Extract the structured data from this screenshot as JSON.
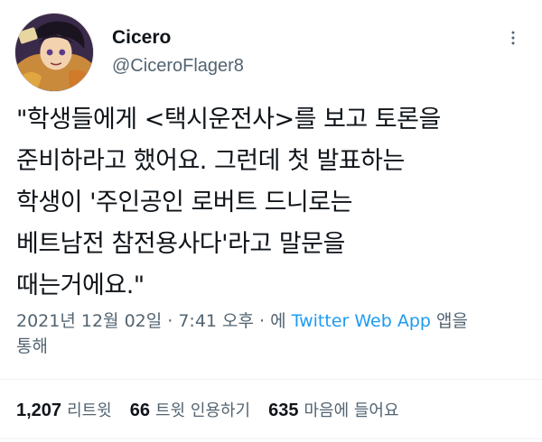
{
  "author": {
    "display_name": "Cicero",
    "handle": "@CiceroFlager8",
    "avatar_icon": "anime-character-avatar"
  },
  "tweet": {
    "lines": [
      "\"학생들에게 <택시운전사>를 보고 토론을",
      "준비하라고 했어요. 그런데 첫 발표하는",
      "학생이 '주인공인 로버트 드니로는",
      "베트남전 참전용사다'라고 말문을",
      "때는거에요.\""
    ]
  },
  "meta": {
    "timestamp": "2021년 12월 02일 · 7:41 오후 · 에 ",
    "source": "Twitter Web App",
    "suffix": " 앱을",
    "suffix_line2": "통해"
  },
  "stats": {
    "retweets": {
      "count": "1,207",
      "label": "리트윗"
    },
    "quotes": {
      "count": "66",
      "label": "트윗 인용하기"
    },
    "likes": {
      "count": "635",
      "label": "마음에 들어요"
    }
  },
  "colors": {
    "link": "#1d9bf0",
    "secondary_text": "#536471",
    "primary_text": "#0f1419"
  }
}
